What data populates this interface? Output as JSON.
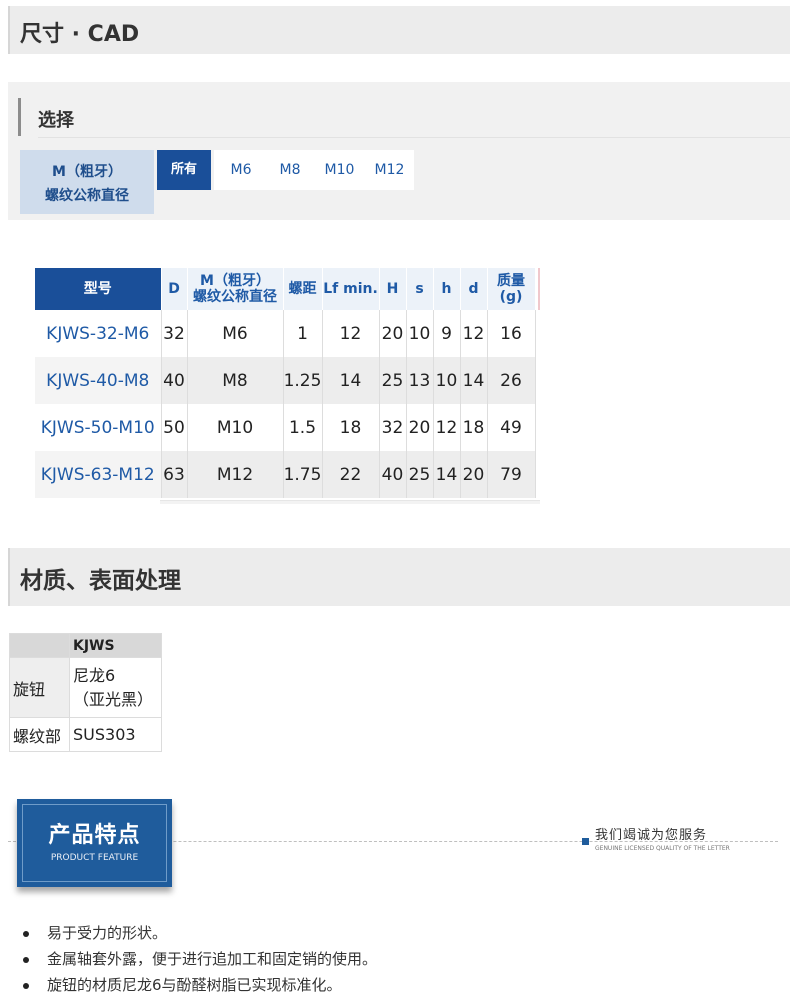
{
  "sections": {
    "dimensions_title": "尺寸 · CAD",
    "material_title": "材质、表面处理"
  },
  "filter": {
    "label": "选择",
    "param_line1": "M（粗牙）",
    "param_line2": "螺纹公称直径",
    "options": [
      "所有",
      "M6",
      "M8",
      "M10",
      "M12"
    ],
    "selected": "所有"
  },
  "spec_table": {
    "headers": [
      "型号",
      "D",
      "M（粗牙）\n螺纹公称直径",
      "螺距",
      "Lf min.",
      "H",
      "s",
      "h",
      "d",
      "质量\n(g)"
    ],
    "header_m_line1": "M（粗牙）",
    "header_m_line2": "螺纹公称直径",
    "header_mass_line1": "质量",
    "header_mass_line2": "(g)",
    "rows": [
      [
        "KJWS-32-M6",
        "32",
        "M6",
        "1",
        "12",
        "20",
        "10",
        "9",
        "12",
        "16"
      ],
      [
        "KJWS-40-M8",
        "40",
        "M8",
        "1.25",
        "14",
        "25",
        "13",
        "10",
        "14",
        "26"
      ],
      [
        "KJWS-50-M10",
        "50",
        "M10",
        "1.5",
        "18",
        "32",
        "20",
        "12",
        "18",
        "49"
      ],
      [
        "KJWS-63-M12",
        "63",
        "M12",
        "1.75",
        "22",
        "40",
        "25",
        "14",
        "20",
        "79"
      ]
    ]
  },
  "material_table": {
    "header": "KJWS",
    "rows": [
      {
        "label": "旋钮",
        "value_line1": "尼龙6",
        "value_line2": "（亚光黑）"
      },
      {
        "label": "螺纹部",
        "value_line1": "SUS303",
        "value_line2": ""
      }
    ]
  },
  "feature_banner": {
    "title_cn": "产品特点",
    "title_en": "PRODUCT FEATURE",
    "service_cn": "我们竭诚为您服务",
    "service_en": "GENUINE LICENSED QUALITY OF THE LETTER"
  },
  "features": [
    "易于受力的形状。",
    "金属轴套外露，便于进行追加工和固定销的使用。",
    "旋钮的材质尼龙6与酚醛树脂已实现标准化。"
  ],
  "colors": {
    "accent": "#1a4f99",
    "header_bg": "#ececec",
    "param_bg": "#cfdcec",
    "link": "#1f5aa6"
  }
}
